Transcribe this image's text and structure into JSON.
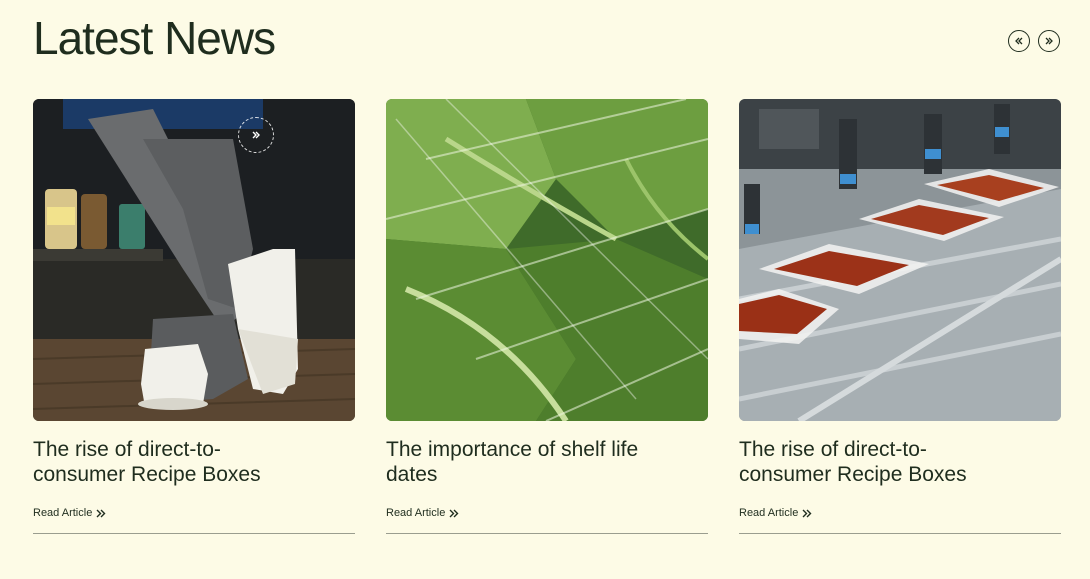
{
  "header": {
    "title": "Latest News",
    "prev_icon": "double-chevron-left-icon",
    "next_icon": "double-chevron-right-icon"
  },
  "articles": [
    {
      "title": "The rise of direct-to-consumer Recipe Boxes",
      "link_label": "Read Article",
      "image": "chef-clogs-photo"
    },
    {
      "title": "The importance of shelf life dates",
      "link_label": "Read Article",
      "image": "wrapped-greens-photo"
    },
    {
      "title": "The rise of direct-to-consumer Recipe Boxes",
      "link_label": "Read Article",
      "image": "meal-tray-production-photo"
    }
  ],
  "colors": {
    "background": "#fdfbe6",
    "text": "#1f2d1e",
    "divider": "#9a9d8f"
  }
}
